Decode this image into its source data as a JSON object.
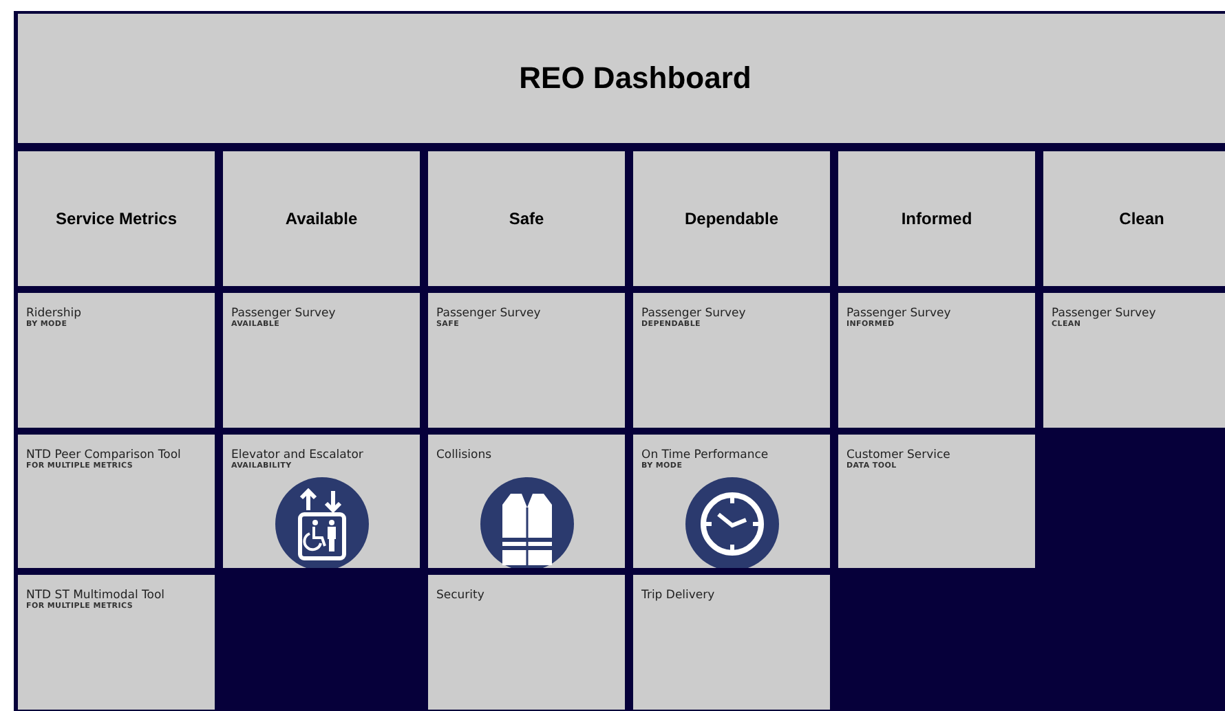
{
  "title": "REO Dashboard",
  "column_headers": [
    "Service Metrics",
    "Available",
    "Safe",
    "Dependable",
    "Informed",
    "Clean"
  ],
  "rows": [
    [
      {
        "kind": "tile",
        "title": "Ridership",
        "subtitle": "BY MODE"
      },
      {
        "kind": "tile",
        "title": "Passenger Survey",
        "subtitle": "AVAILABLE"
      },
      {
        "kind": "tile",
        "title": "Passenger Survey",
        "subtitle": "SAFE"
      },
      {
        "kind": "tile",
        "title": "Passenger Survey",
        "subtitle": "DEPENDABLE"
      },
      {
        "kind": "tile",
        "title": "Passenger Survey",
        "subtitle": "INFORMED"
      },
      {
        "kind": "tile",
        "title": "Passenger Survey",
        "subtitle": "CLEAN"
      }
    ],
    [
      {
        "kind": "tile",
        "title": "NTD Peer Comparison Tool",
        "subtitle": "FOR MULTIPLE METRICS"
      },
      {
        "kind": "elevator_tile",
        "title": "Elevator and Escalator",
        "subtitle": "AVAILABILITY"
      },
      {
        "kind": "vest_tile",
        "title": "Collisions"
      },
      {
        "kind": "clock_tile",
        "title": "On Time Performance",
        "subtitle": "BY MODE"
      },
      {
        "kind": "tile",
        "title": "Customer Service",
        "subtitle": "DATA TOOL"
      },
      {
        "kind": "empty"
      }
    ],
    [
      {
        "kind": "tile",
        "title": "NTD ST Multimodal Tool",
        "subtitle": "FOR MULTIPLE METRICS"
      },
      {
        "kind": "empty"
      },
      {
        "kind": "tile",
        "title": "Security"
      },
      {
        "kind": "tile",
        "title": "Trip Delivery"
      },
      {
        "kind": "empty"
      },
      {
        "kind": "empty"
      }
    ]
  ]
}
